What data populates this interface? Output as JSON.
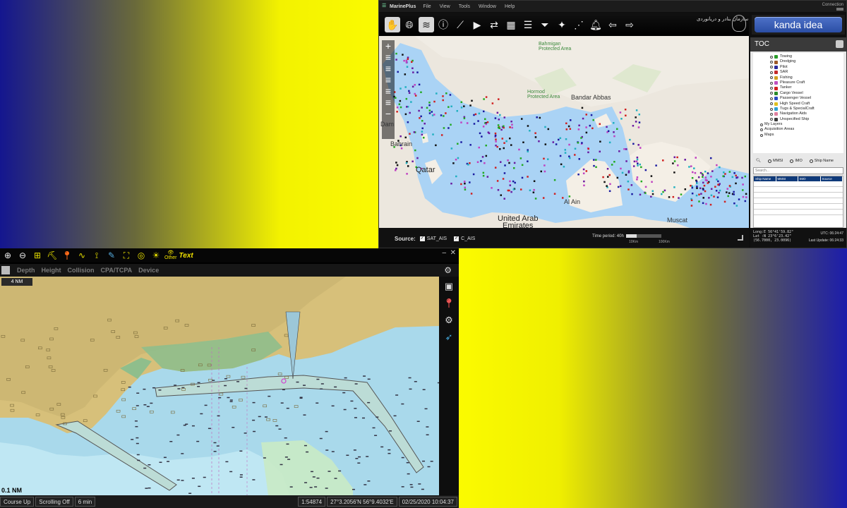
{
  "marineplus": {
    "app_name": "MarinePlus",
    "menu": [
      "File",
      "View",
      "Tools",
      "Window",
      "Help"
    ],
    "connection": "Connection",
    "org_name": "سازمان بنادر و دریانوردی",
    "brand": "kanda idea",
    "map_labels": {
      "bahrain": "Bahrain",
      "qatar": "Qatar",
      "uae": "United Arab\nEmirates",
      "bandar_abbas": "Bandar Abbas",
      "al_ain": "Al Ain",
      "muscat": "Muscat",
      "bahmigan": "Bahmigan\nProtected Area",
      "hormod": "Hormod\nProtected Area",
      "dam": "Dam"
    },
    "toc": {
      "title": "TOC",
      "layers": [
        {
          "label": "Towing",
          "color": "#2a9c2a"
        },
        {
          "label": "Dredging",
          "color": "#9c5a2a"
        },
        {
          "label": "Pilot",
          "color": "#2a2a9c"
        },
        {
          "label": "SAR",
          "color": "#c42a2a"
        },
        {
          "label": "Fishing",
          "color": "#d0a020"
        },
        {
          "label": "Pleasure Craft",
          "color": "#c04fc0"
        },
        {
          "label": "Tanker",
          "color": "#d02020"
        },
        {
          "label": "Cargo Vessel",
          "color": "#2a8a2a"
        },
        {
          "label": "Passenger Vessel",
          "color": "#2a4ac0"
        },
        {
          "label": "High Speed Craft",
          "color": "#e0c020"
        },
        {
          "label": "Tugs & SpecialCraft",
          "color": "#30a0d0"
        },
        {
          "label": "Navigation Aids",
          "color": "#e080a0"
        },
        {
          "label": "Unspecified Ship",
          "color": "#3a3a3a"
        }
      ],
      "groups": [
        "My Layers",
        "Acquisition Areas",
        "Maps"
      ],
      "search_options": [
        "MMSI",
        "IMO",
        "Ship Name"
      ],
      "search_placeholder": "Search...",
      "table_headers": [
        "Ship Name",
        "MMSI",
        "IMO",
        "Source"
      ]
    },
    "status": {
      "source_label": "Source:",
      "sources": [
        "SAT_AIS",
        "C_AIS"
      ],
      "time_period": "Time period: 40h",
      "time_min": "10Km",
      "time_max": "100Km",
      "time_fill": 0.3
    },
    "coords": {
      "long": "Long:E 56°41'59.82\"",
      "lat": "Lat :N 23°6'23.42\"",
      "xy": "(56.7000, 23.0096)",
      "utc": "UTC: 06:24:47",
      "last_update": "Last Update: 06:24:33"
    }
  },
  "ecdis": {
    "toolbar_labels": {
      "other": "Other",
      "text": "Text"
    },
    "tabs": [
      "Depth",
      "Height",
      "Collision",
      "CPA/TCPA",
      "Device"
    ],
    "range": "4 NM",
    "scale_label": "0.1 NM",
    "status": [
      "Course Up",
      "Scrolling Off",
      "6 min",
      "1:54874",
      "27°3.2056'N  56°9.4032'E",
      "02/25/2020 10:04:37"
    ]
  }
}
